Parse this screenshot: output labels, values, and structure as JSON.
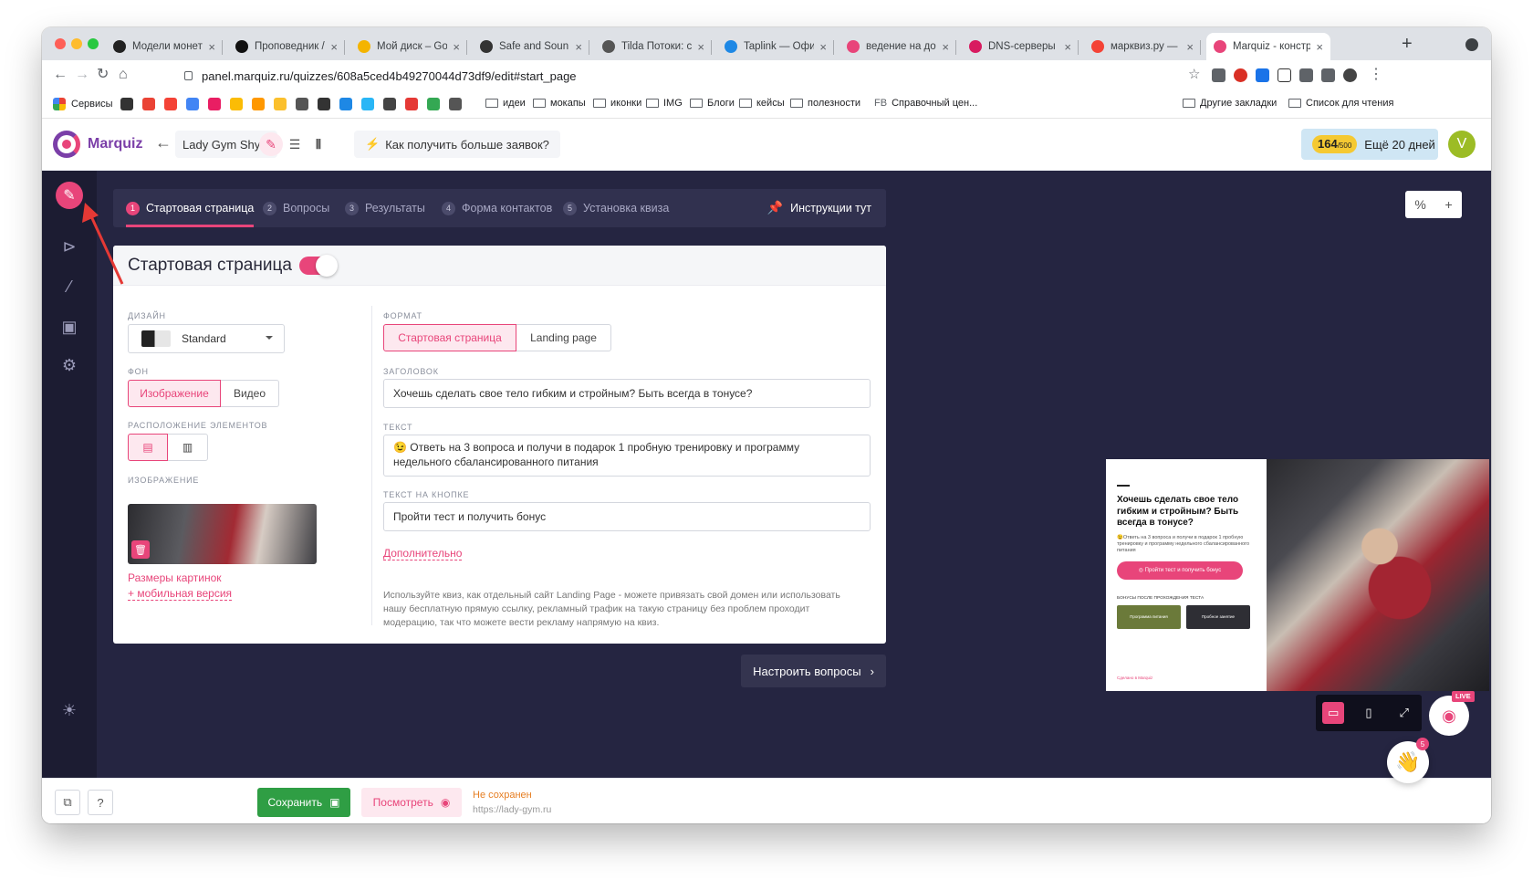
{
  "browser": {
    "tabs": [
      {
        "label": "Модели монетиза",
        "icon": "mask-icon",
        "color": "#222"
      },
      {
        "label": "Проповедник / Pr",
        "icon": "p-icon",
        "color": "#111"
      },
      {
        "label": "Мой диск – Googl",
        "icon": "drive-icon",
        "color": "#f4b400"
      },
      {
        "label": "Safe and Soun",
        "icon": "play-icon",
        "color": "#333"
      },
      {
        "label": "Tilda Потоки: craft",
        "icon": "tilda-icon",
        "color": "#555"
      },
      {
        "label": "Taplink — Официа",
        "icon": "taplink-icon",
        "color": "#1e88e5"
      },
      {
        "label": "ведение на доске",
        "icon": "trello-icon",
        "color": "#e8457a"
      },
      {
        "label": "DNS-серверы и у",
        "icon": "dns-icon",
        "color": "#d81b60"
      },
      {
        "label": "марквиз.ру — Янд",
        "icon": "yandex-icon",
        "color": "#f44336"
      },
      {
        "label": "Marquiz - констру",
        "icon": "marquiz-icon",
        "color": "#e8457a"
      }
    ],
    "url": "panel.marquiz.ru/quizzes/608a5ced4b49270044d73df9/edit#start_page"
  },
  "bookmarks": {
    "services": "Сервисы",
    "folders": [
      "идеи",
      "мокапы",
      "иконки",
      "IMG",
      "Блоги",
      "кейсы",
      "полезности"
    ],
    "fb": "Справочный цен...",
    "other": "Другие закладки",
    "reading": "Список для чтения"
  },
  "header": {
    "brand": "Marquiz",
    "quiz_name": "Lady Gym Shym",
    "howto": "Как получить больше заявок?",
    "balance": "164",
    "balance_max": "/500",
    "days": "Ещё 20 дней",
    "avatar": "V"
  },
  "steps": [
    {
      "num": "1",
      "label": "Стартовая страница",
      "active": true
    },
    {
      "num": "2",
      "label": "Вопросы",
      "active": false
    },
    {
      "num": "3",
      "label": "Результаты",
      "active": false
    },
    {
      "num": "4",
      "label": "Форма контактов",
      "active": false
    },
    {
      "num": "5",
      "label": "Установка квиза",
      "active": false
    }
  ],
  "instructions": "Инструкции тут",
  "card": {
    "title": "Стартовая страница",
    "design_label": "ДИЗАЙН",
    "design_value": "Standard",
    "bg_label": "ФОН",
    "bg_options": [
      "Изображение",
      "Видео"
    ],
    "layout_label": "РАСПОЛОЖЕНИЕ ЭЛЕМЕНТОВ",
    "image_label": "ИЗОБРАЖЕНИЕ",
    "sizes_link": "Размеры картинок",
    "mobile_link": "+ мобильная версия",
    "format_label": "ФОРМАТ",
    "format_options": [
      "Стартовая страница",
      "Landing page"
    ],
    "heading_label": "ЗАГОЛОВОК",
    "heading_value": "Хочешь сделать свое тело гибким и стройным? Быть всегда в тонусе?",
    "text_label": "ТЕКСТ",
    "text_value": "😉 Ответь на 3 вопроса и получи в подарок 1 пробную тренировку и программу недельного сбалансированного питания",
    "button_label": "ТЕКСТ НА КНОПКЕ",
    "button_value": "Пройти тест и получить бонус",
    "more_link": "Дополнительно",
    "hint": "Используйте квиз, как отдельный сайт Landing Page - можете привязать свой домен или использовать нашу бесплатную прямую ссылку, рекламный трафик на такую страницу без проблем проходит модерацию, так что можете вести рекламу напрямую на квиз."
  },
  "next_button": "Настроить вопросы",
  "zoom": {
    "percent": "%",
    "plus": "+"
  },
  "preview": {
    "title": "Хочешь сделать свое тело гибким и стройным? Быть всегда в тонусе?",
    "desc": "😉Ответь на 3 вопроса и получи в подарок 1 пробную тренировку и программу недельного сбалансированного питания",
    "button": "◎ Пройти тест и получить бонус",
    "bonuses": "Бонусы после прохождения теста",
    "bonus_cards": [
      "Программа питания",
      "Пробное занятие"
    ],
    "footer": "Сделано в Marquiz"
  },
  "live_badge": "LIVE",
  "hand_badge": "5",
  "footer": {
    "save": "Сохранить",
    "view": "Посмотреть",
    "status": "Не сохранен",
    "site": "https://lady-gym.ru"
  },
  "colors": {
    "accent": "#e8457a",
    "dark": "#252541",
    "save": "#2f9e44"
  }
}
